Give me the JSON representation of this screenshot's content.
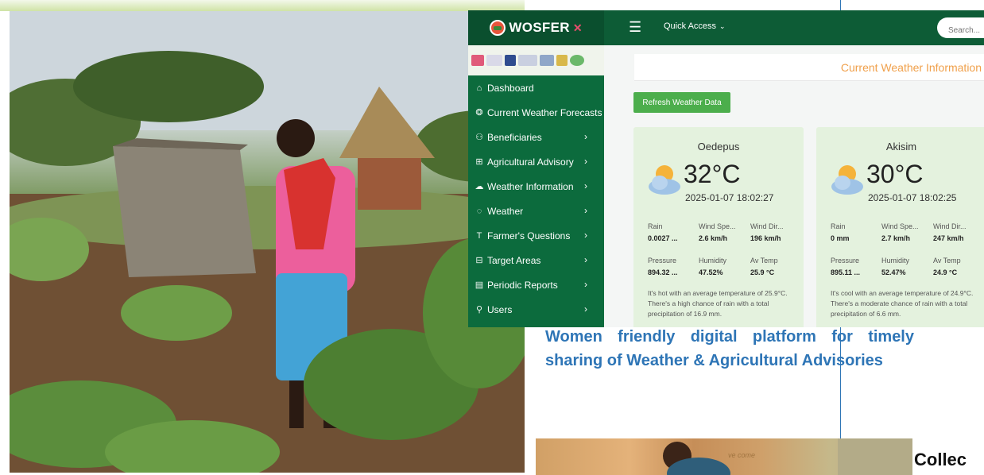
{
  "app": {
    "brand": "WOSFER",
    "menu_icon": "hamburger-icon",
    "quick_access": "Quick Access",
    "search_placeholder": "Search...",
    "sidebar": [
      {
        "label": "Dashboard",
        "icon": "home-icon",
        "has_submenu": false
      },
      {
        "label": "Current Weather Forecasts",
        "icon": "weather-forecast-icon",
        "has_submenu": false
      },
      {
        "label": "Beneficiaries",
        "icon": "users-icon",
        "has_submenu": true
      },
      {
        "label": "Agricultural Advisory",
        "icon": "grid-icon",
        "has_submenu": true
      },
      {
        "label": "Weather Information",
        "icon": "cloud-icon",
        "has_submenu": true
      },
      {
        "label": "Weather",
        "icon": "chat-icon",
        "has_submenu": true
      },
      {
        "label": "Farmer's Questions",
        "icon": "text-icon",
        "has_submenu": true
      },
      {
        "label": "Target Areas",
        "icon": "map-icon",
        "has_submenu": true
      },
      {
        "label": "Periodic Reports",
        "icon": "report-icon",
        "has_submenu": true
      },
      {
        "label": "Users",
        "icon": "user-icon",
        "has_submenu": true
      }
    ],
    "page_title": "Current Weather Information",
    "refresh_button": "Refresh Weather Data",
    "cards": [
      {
        "location": "Oedepus",
        "temperature": "32°C",
        "datetime": "2025-01-07 18:02:27",
        "icon": "partly-cloudy-icon",
        "metrics": {
          "rain_label": "Rain",
          "rain": "0.0027 ...",
          "wind_speed_label": "Wind Spe...",
          "wind_speed": "2.6 km/h",
          "wind_dir_label": "Wind Dir...",
          "wind_dir": "196 km/h",
          "pressure_label": "Pressure",
          "pressure": "894.32 ...",
          "humidity_label": "Humidity",
          "humidity": "47.52%",
          "avg_temp_label": "Av Temp",
          "avg_temp": "25.9 °C"
        },
        "summary": "It's hot with an average temperature of 25.9°C. There's a high chance of rain with a total precipitation of 16.9 mm."
      },
      {
        "location": "Akisim",
        "temperature": "30°C",
        "datetime": "2025-01-07 18:02:25",
        "icon": "partly-cloudy-icon",
        "metrics": {
          "rain_label": "Rain",
          "rain": "0 mm",
          "wind_speed_label": "Wind Spe...",
          "wind_speed": "2.7 km/h",
          "wind_dir_label": "Wind Dir...",
          "wind_dir": "247 km/h",
          "pressure_label": "Pressure",
          "pressure": "895.11 ...",
          "humidity_label": "Humidity",
          "humidity": "52.47%",
          "avg_temp_label": "Av Temp",
          "avg_temp": "24.9 °C"
        },
        "summary": "It's cool with an average temperature of 24.9°C. There's a moderate chance of rain with a total precipitation of 6.6 mm."
      }
    ]
  },
  "page": {
    "caption": "Women friendly digital platform for timely sharing of Weather & Agricultural Advisories",
    "bottom_heading": "Collec",
    "bottom_wall_text": "ve come"
  },
  "colors": {
    "brand_dark": "#0a4f2e",
    "brand_green": "#0c6b3d",
    "accent_orange": "#f0a04b",
    "button_green": "#4cae4c",
    "caption_blue": "#2e75b6"
  }
}
